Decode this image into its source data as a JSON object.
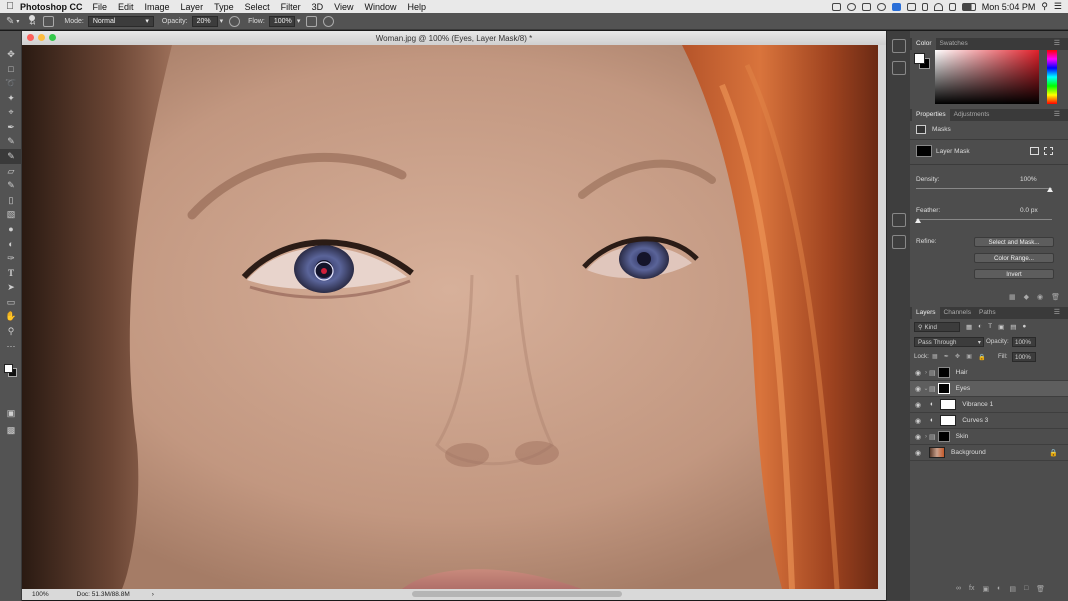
{
  "menubar": {
    "app": "Photoshop CC",
    "menus": [
      "File",
      "Edit",
      "Image",
      "Layer",
      "Type",
      "Select",
      "Filter",
      "3D",
      "View",
      "Window",
      "Help"
    ],
    "clock": "Mon 5:04 PM"
  },
  "options": {
    "brush_size": "44",
    "mode_label": "Mode:",
    "mode_value": "Normal",
    "opacity_label": "Opacity:",
    "opacity_value": "20%",
    "flow_label": "Flow:",
    "flow_value": "100%"
  },
  "document": {
    "title": "Woman.jpg @ 100% (Eyes, Layer Mask/8) *",
    "zoom": "100%",
    "doc_info": "Doc: 51.3M/88.8M"
  },
  "color_panel": {
    "tabs": [
      "Color",
      "Swatches"
    ],
    "foreground": "#ffffff",
    "background": "#000000"
  },
  "properties": {
    "tabs": [
      "Properties",
      "Adjustments"
    ],
    "section": "Masks",
    "mask_type": "Layer Mask",
    "density_label": "Density:",
    "density_value": "100%",
    "feather_label": "Feather:",
    "feather_value": "0.0 px",
    "refine_label": "Refine:",
    "select_and_mask": "Select and Mask...",
    "color_range": "Color Range...",
    "invert": "Invert"
  },
  "layers_panel": {
    "tabs": [
      "Layers",
      "Channels",
      "Paths"
    ],
    "filter_kind": "Kind",
    "blend_mode": "Pass Through",
    "opacity_label": "Opacity:",
    "opacity_value": "100%",
    "lock_label": "Lock:",
    "fill_label": "Fill:",
    "fill_value": "100%",
    "layers": [
      {
        "name": "Hair",
        "type": "group"
      },
      {
        "name": "Eyes",
        "type": "group",
        "selected": true
      },
      {
        "name": "Vibrance 1",
        "type": "adjustment"
      },
      {
        "name": "Curves 3",
        "type": "adjustment"
      },
      {
        "name": "Skin",
        "type": "group"
      },
      {
        "name": "Background",
        "type": "image"
      }
    ]
  }
}
